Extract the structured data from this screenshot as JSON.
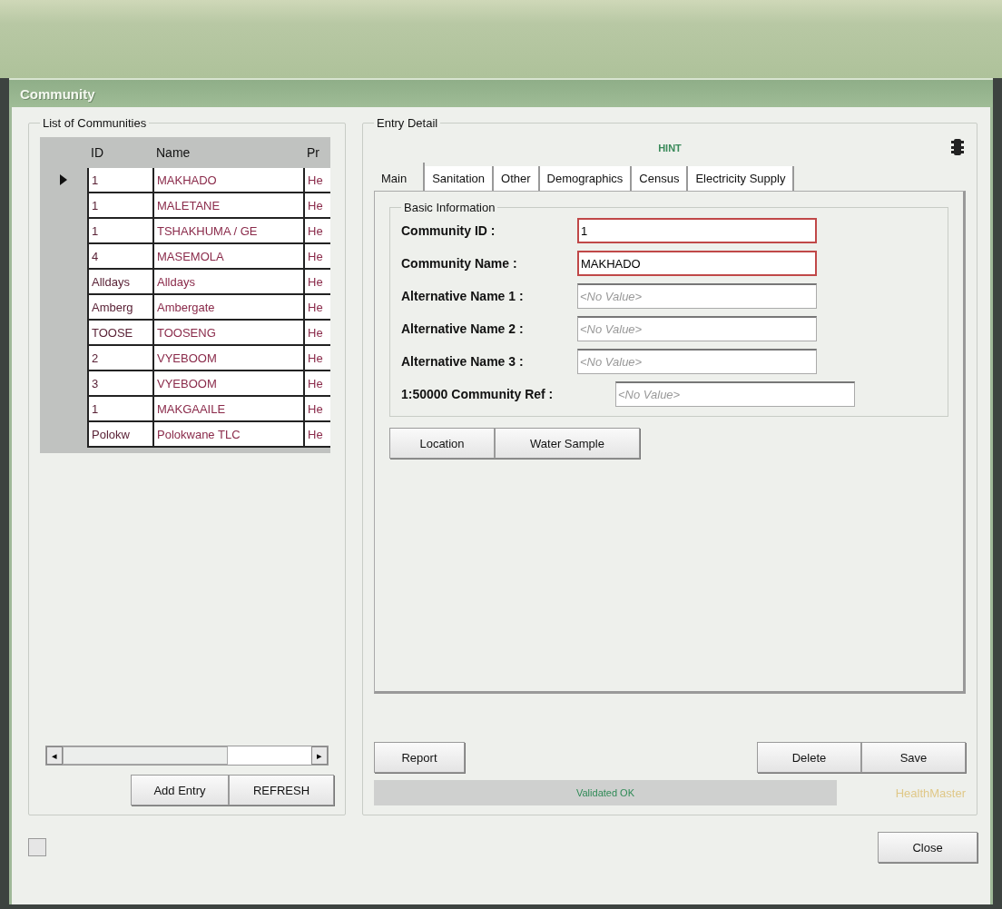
{
  "window": {
    "title": "Community"
  },
  "list_panel": {
    "title": "List of Communities",
    "columns": [
      "ID",
      "Name",
      "Pr"
    ],
    "rows": [
      {
        "id": "1",
        "name": "MAKHADO",
        "column_3": "He",
        "selected": true
      },
      {
        "id": "1",
        "name": "MALETANE",
        "column_3": "He",
        "selected": false
      },
      {
        "id": "1",
        "name": "TSHAKHUMA / GE",
        "column_3": "He",
        "selected": false
      },
      {
        "id": "4",
        "name": "MASEMOLA",
        "column_3": "He",
        "selected": false
      },
      {
        "id": "Alldays",
        "name": "Alldays",
        "column_3": "He",
        "selected": false
      },
      {
        "id": "Amberg",
        "name": "Ambergate",
        "column_3": "He",
        "selected": false
      },
      {
        "id": "TOOSE",
        "name": "TOOSENG",
        "column_3": "He",
        "selected": false
      },
      {
        "id": "2",
        "name": "VYEBOOM",
        "column_3": "He",
        "selected": false
      },
      {
        "id": "3",
        "name": "VYEBOOM",
        "column_3": "He",
        "selected": false
      },
      {
        "id": "1",
        "name": "MAKGAAILE",
        "column_3": "He",
        "selected": false
      },
      {
        "id": "Polokw",
        "name": "Polokwane TLC",
        "column_3": "He",
        "selected": false
      }
    ],
    "scroll_left": "◂",
    "scroll_right": "▸",
    "buttons": [
      "Add Entry",
      "REFRESH"
    ]
  },
  "detail_panel": {
    "title": "Entry Detail",
    "hint": "HINT",
    "tabs": [
      {
        "label": "Main",
        "selected": true
      },
      {
        "label": "Sanitation",
        "selected": false
      },
      {
        "label": "Other",
        "selected": false
      },
      {
        "label": "Demographics",
        "selected": false
      },
      {
        "label": "Census",
        "selected": false
      },
      {
        "label": "Electricity Supply",
        "selected": false
      }
    ],
    "group_title": "Basic Information",
    "fields": [
      {
        "label": "Community ID :",
        "value": "1",
        "required": true
      },
      {
        "label": "Community Name :",
        "value": "MAKHADO",
        "required": true
      },
      {
        "label": "Alternative Name 1 :",
        "placeholder": "<No Value>",
        "required": false
      },
      {
        "label": "Alternative Name 2 :",
        "placeholder": "<No Value>",
        "required": false
      },
      {
        "label": "Alternative Name 3 :",
        "placeholder": "<No Value>",
        "required": false
      },
      {
        "label": "1:50000 Community Ref :",
        "placeholder": "<No Value>",
        "required": false
      }
    ],
    "sub_buttons": [
      "Location",
      "Water Sample"
    ],
    "report_button": "Report",
    "action_buttons": [
      "Delete",
      "Save"
    ],
    "status": "Validated OK",
    "brand": "HealthMaster"
  },
  "close_button": "Close"
}
